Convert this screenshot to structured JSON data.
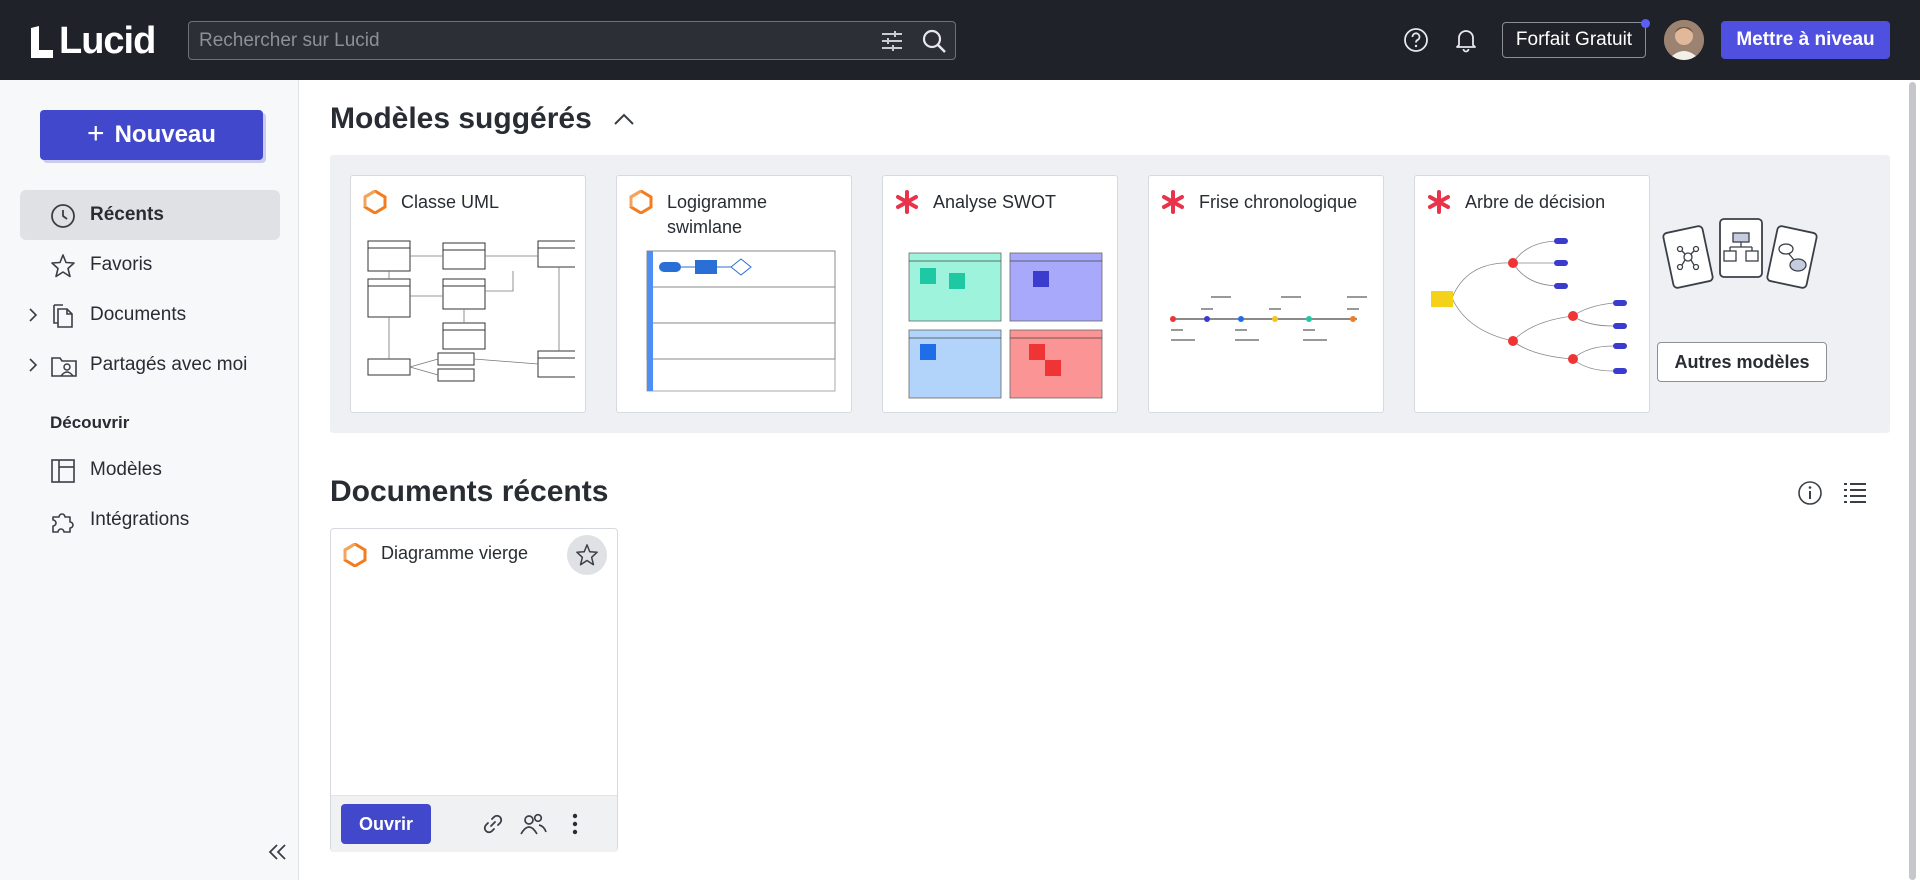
{
  "topbar": {
    "logo_text": "Lucid",
    "search_placeholder": "Rechercher sur Lucid",
    "plan_label": "Forfait Gratuit",
    "upgrade_label": "Mettre à niveau"
  },
  "sidebar": {
    "new_label": "Nouveau",
    "items": [
      {
        "label": "Récents",
        "icon": "clock-icon",
        "active": true
      },
      {
        "label": "Favoris",
        "icon": "star-icon"
      },
      {
        "label": "Documents",
        "icon": "documents-icon",
        "expandable": true
      },
      {
        "label": "Partagés avec moi",
        "icon": "shared-folder-icon",
        "expandable": true
      }
    ],
    "discover_label": "Découvrir",
    "discover_items": [
      {
        "label": "Modèles",
        "icon": "templates-icon"
      },
      {
        "label": "Intégrations",
        "icon": "puzzle-icon"
      }
    ]
  },
  "main": {
    "suggested_heading": "Modèles suggérés",
    "templates": [
      {
        "title": "Classe UML",
        "icon": "lucidchart-icon"
      },
      {
        "title": "Logigramme swimlane",
        "icon": "lucidchart-icon"
      },
      {
        "title": "Analyse SWOT",
        "icon": "lucidspark-icon"
      },
      {
        "title": "Frise chronologique",
        "icon": "lucidspark-icon"
      },
      {
        "title": "Arbre de décision",
        "icon": "lucidspark-icon"
      }
    ],
    "more_templates_label": "Autres modèles",
    "recent_heading": "Documents récents",
    "documents": [
      {
        "title": "Diagramme vierge",
        "open_label": "Ouvrir"
      }
    ]
  },
  "colors": {
    "topbar": "#1f2329",
    "primary": "#4148cc",
    "upgrade": "#4f4fe0",
    "lucidchart_orange": "#f27c1f",
    "lucidspark_red": "#e8334a"
  }
}
